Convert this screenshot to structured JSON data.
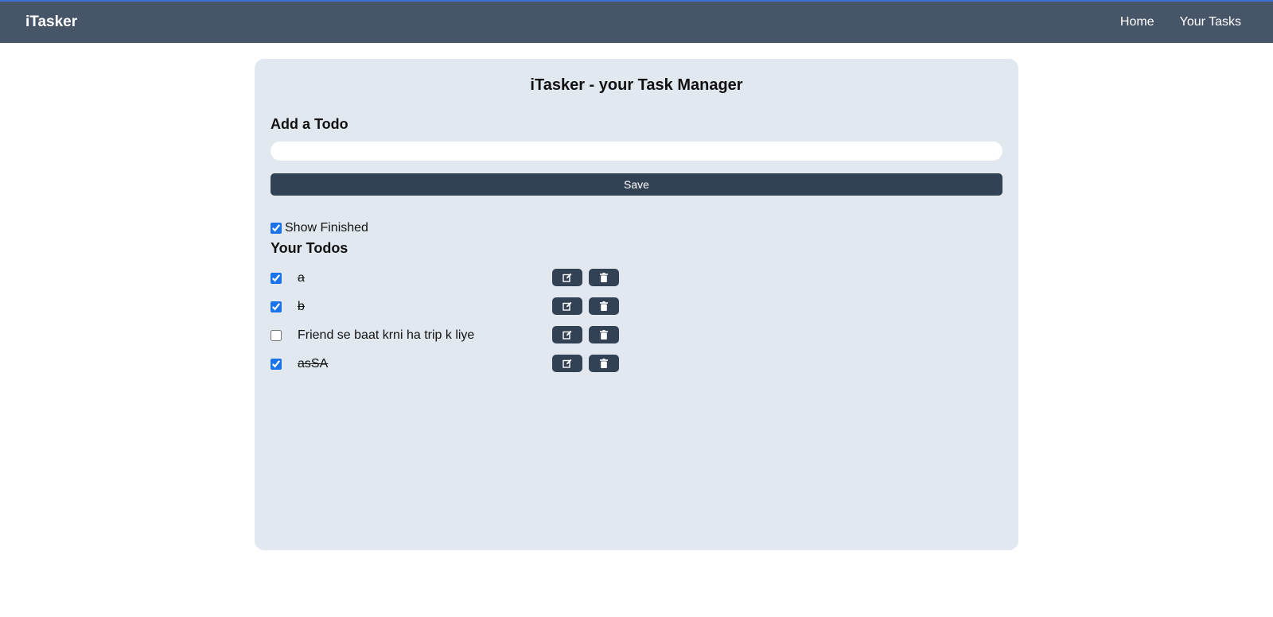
{
  "navbar": {
    "brand": "iTasker",
    "links": [
      "Home",
      "Your Tasks"
    ]
  },
  "main": {
    "title": "iTasker - your Task Manager",
    "add_heading": "Add a Todo",
    "input_value": "",
    "save_label": "Save",
    "show_finished_label": "Show Finished",
    "show_finished_checked": true,
    "todos_heading": "Your Todos"
  },
  "todos": [
    {
      "text": "a",
      "done": true
    },
    {
      "text": "b",
      "done": true
    },
    {
      "text": "Friend se baat krni ha trip k liye",
      "done": false
    },
    {
      "text": "asSA",
      "done": true
    }
  ],
  "icons": {
    "edit": "edit-icon",
    "delete": "trash-icon"
  },
  "colors": {
    "navbar": "#475569",
    "card": "#e2e8f0",
    "button": "#334155",
    "checkbox": "#1a73e8"
  }
}
